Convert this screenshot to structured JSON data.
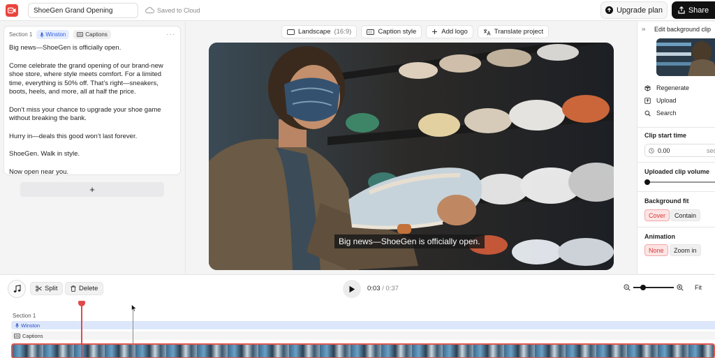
{
  "app": {
    "project_name": "ShoeGen Grand Opening",
    "save_status": "Saved to Cloud",
    "upgrade_label": "Upgrade plan",
    "share_label": "Share"
  },
  "script": {
    "section_label": "Section 1",
    "voice_chip": "Winston",
    "captions_chip": "Captions",
    "menu_glyph": "···",
    "paragraphs": [
      "Big news—ShoeGen is officially open.",
      "Come celebrate the grand opening of our brand-new shoe store, where style meets comfort. For a limited time, everything is 50% off. That’s right—sneakers, boots, heels, and more, all at half the price.",
      "Don’t miss your chance to upgrade your shoe game without breaking the bank.",
      "Hurry in—deals this good won’t last forever.",
      "ShoeGen. Walk in style.",
      "Now open near you."
    ],
    "add_section_glyph": "+"
  },
  "preview_toolbar": {
    "aspect_label": "Landscape",
    "aspect_ratio": "(16:9)",
    "caption_style": "Caption style",
    "add_logo": "Add logo",
    "translate": "Translate project"
  },
  "preview": {
    "caption_text": "Big news—ShoeGen is officially open."
  },
  "inspector": {
    "title": "Edit background clip",
    "regenerate": "Regenerate",
    "upload": "Upload",
    "search": "Search",
    "clip_start_label": "Clip start time",
    "clip_start_value": "0.00",
    "clip_start_unit": "sec",
    "volume_label": "Uploaded clip volume",
    "volume_level": 0,
    "fit_label": "Background fit",
    "fit_options": [
      "Cover",
      "Contain"
    ],
    "fit_selected": "Cover",
    "animation_label": "Animation",
    "animation_options": [
      "None",
      "Zoom in"
    ],
    "animation_selected": "None"
  },
  "timeline": {
    "split_label": "Split",
    "delete_label": "Delete",
    "current_time": "0:03",
    "time_separator": " / ",
    "total_time": "0:37",
    "fit_label": "Fit",
    "section_label": "Section 1",
    "voice_track": "Winston",
    "captions_track": "Captions"
  },
  "colors": {
    "accent_red": "#e04a4a",
    "voice_blue": "#2b52c4",
    "share_bg": "#111111"
  }
}
